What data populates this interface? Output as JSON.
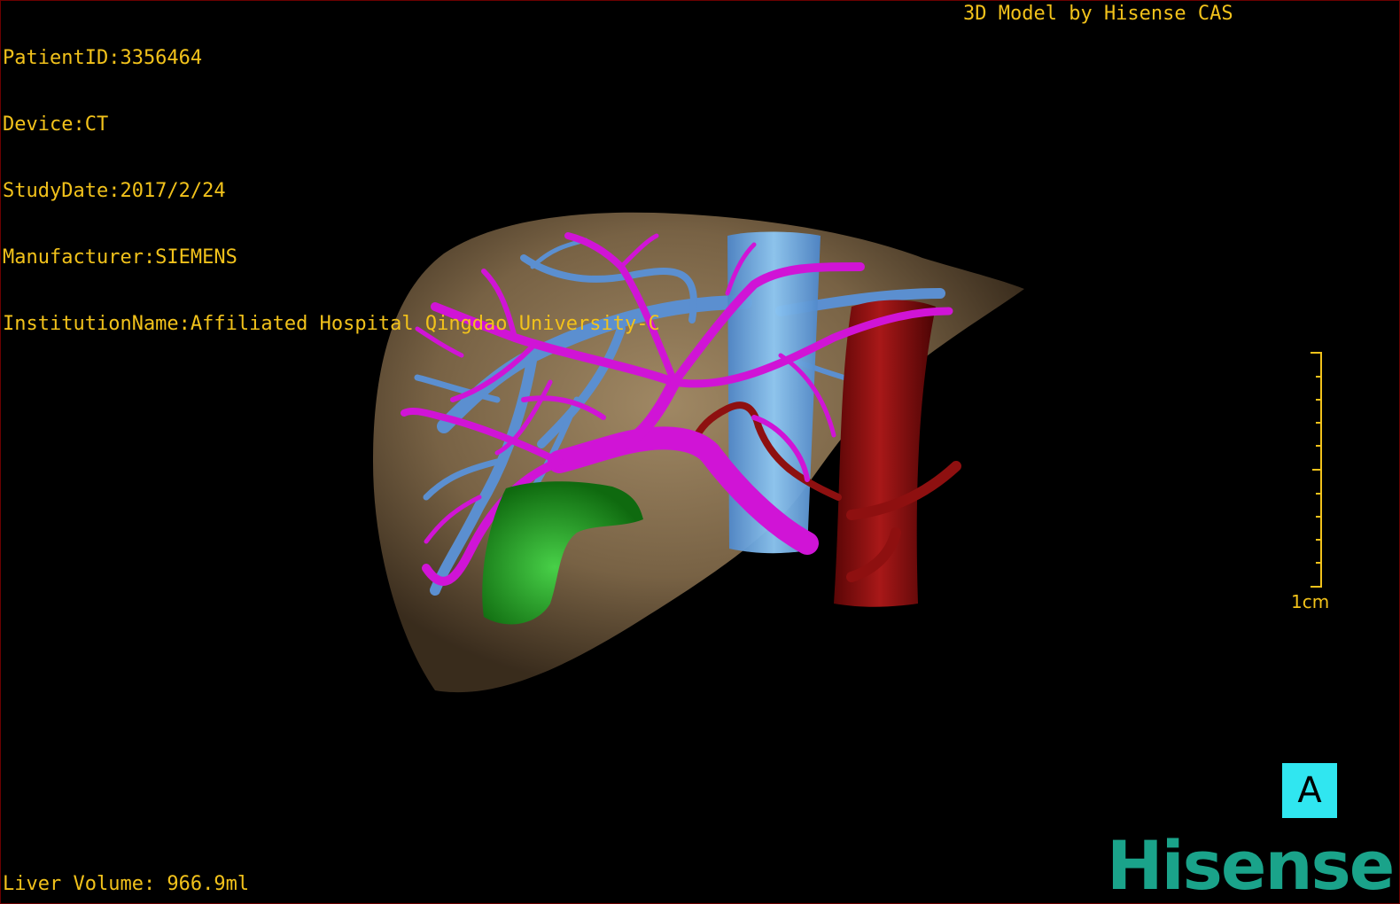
{
  "overlay": {
    "patient_id": "PatientID:3356464",
    "device": "Device:CT",
    "study_date": "StudyDate:2017/2/24",
    "manufacturer": "Manufacturer:SIEMENS",
    "institution": "InstitutionName:Affiliated Hospital Qingdao University-C",
    "title": "3D Model by Hisense CAS",
    "liver_volume": "Liver Volume: 966.9ml"
  },
  "scale_bar": {
    "label": "1cm"
  },
  "orientation": {
    "label": "A",
    "color": "#30e6f0"
  },
  "brand": {
    "logo_text": "Hisense",
    "color": "#1aa38a"
  },
  "colors": {
    "text": "#f2c21b",
    "liver": "#8a7352",
    "portal_vein": "#d014d6",
    "hepatic_vein": "#5b8fd0",
    "vena_cava": "#6fb4ec",
    "aorta": "#8e1010",
    "gallbladder": "#1f9a1f"
  }
}
